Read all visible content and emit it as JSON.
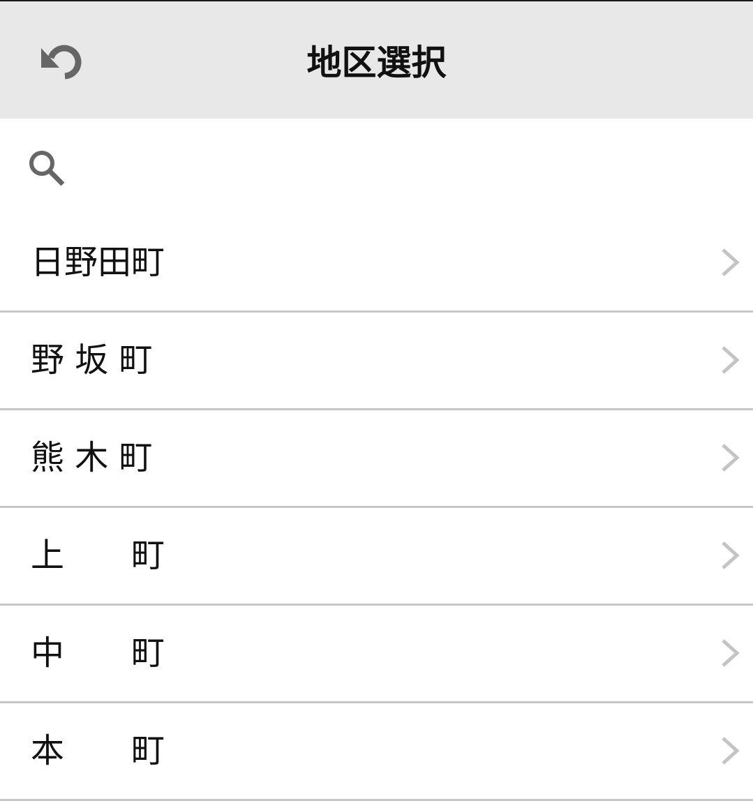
{
  "header": {
    "title": "地区選択",
    "back_icon": "undo-icon"
  },
  "search": {
    "icon": "search-icon",
    "value": "",
    "placeholder": ""
  },
  "districts": [
    {
      "label": "日野田町"
    },
    {
      "label": "野 坂 町"
    },
    {
      "label": "熊 木 町"
    },
    {
      "label": "上　　町"
    },
    {
      "label": "中　　町"
    },
    {
      "label": "本　　町"
    }
  ],
  "colors": {
    "header_bg": "#e8e8e8",
    "icon_gray": "#666666",
    "chevron_gray": "#c4c4c4",
    "divider": "#c6c6c6"
  }
}
